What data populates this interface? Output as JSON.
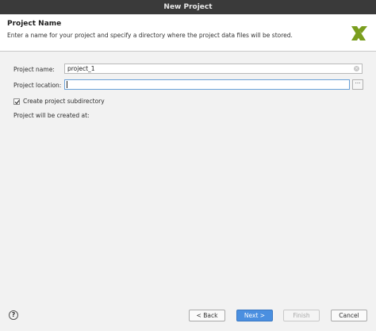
{
  "window": {
    "title": "New Project"
  },
  "header": {
    "title": "Project Name",
    "description": "Enter a name for your project and specify a directory where the project data files will be stored."
  },
  "form": {
    "name_label": "Project name:",
    "name_value": "project_1",
    "location_label": "Project location:",
    "location_value": "",
    "browse_label": "···",
    "subdir_checkbox_label": "Create project subdirectory",
    "subdir_checked": true,
    "created_at_label": "Project will be created at:"
  },
  "footer": {
    "help_label": "?",
    "back_label": "< Back",
    "next_label": "Next >",
    "finish_label": "Finish",
    "cancel_label": "Cancel"
  },
  "colors": {
    "accent": "#4a8fe0",
    "logo_green": "#7a9e1e",
    "titlebar": "#3a3a3a"
  }
}
